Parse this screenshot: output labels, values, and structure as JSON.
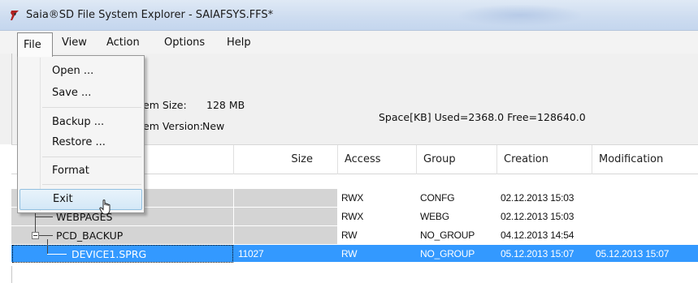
{
  "window": {
    "title": "Saia®SD File System Explorer - SAIAFSYS.FFS*",
    "icon": "saia-app-icon"
  },
  "menubar": {
    "items": [
      "File",
      "View",
      "Action",
      "Options",
      "Help"
    ],
    "active": "File"
  },
  "file_menu": {
    "items": [
      {
        "label": "Open ..."
      },
      {
        "label": "Save ..."
      },
      {
        "label": "Backup ..."
      },
      {
        "label": "Restore ..."
      },
      {
        "label": "Format"
      },
      {
        "label": "Exit",
        "hovered": true
      }
    ]
  },
  "info": {
    "size_label_partial": "em Size:",
    "size_value": "128 MB",
    "version_label_partial": "em Version:",
    "version_value": "New",
    "space": "Space[KB]  Used=2368.0  Free=128640.0"
  },
  "table": {
    "columns": [
      "Size",
      "Access",
      "Group",
      "Creation",
      "Modification"
    ],
    "rows": [
      {
        "name": "",
        "size": "",
        "access": "RWX",
        "group": "CONFG",
        "creation": "02.12.2013 15:03",
        "modification": "",
        "selected": false
      },
      {
        "name": "WEBPAGES",
        "size": "",
        "access": "RWX",
        "group": "WEBG",
        "creation": "02.12.2013 15:03",
        "modification": "",
        "selected": false
      },
      {
        "name": "PCD_BACKUP",
        "size": "",
        "access": "RW",
        "group": "NO_GROUP",
        "creation": "04.12.2013 14:54",
        "modification": "",
        "selected": false
      },
      {
        "name": "DEVICE1.SPRG",
        "size": "11027",
        "access": "RW",
        "group": "NO_GROUP",
        "creation": "05.12.2013 15:07",
        "modification": "05.12.2013 15:07",
        "selected": true
      }
    ]
  },
  "colors": {
    "selection": "#3399ff",
    "row_shade": "#d4d4d4",
    "titlebar": "#cddcf0"
  }
}
